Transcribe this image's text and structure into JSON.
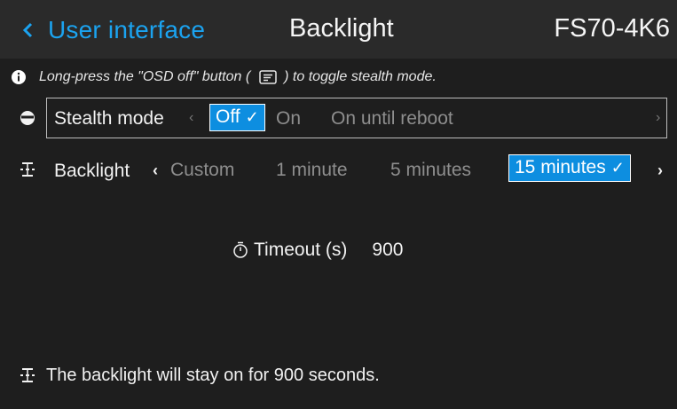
{
  "header": {
    "back_label": "User interface",
    "title": "Backlight",
    "device": "FS70-4K6"
  },
  "info": {
    "text_before": "Long-press the \"OSD off\" button (",
    "text_after": ") to toggle stealth mode."
  },
  "stealth": {
    "label": "Stealth mode",
    "options": [
      "Off",
      "On",
      "On until reboot"
    ],
    "selected": "Off",
    "check": "✓"
  },
  "backlight": {
    "label": "Backlight",
    "options": [
      "Custom",
      "1 minute",
      "5 minutes",
      "15 minutes"
    ],
    "selected": "15 minutes",
    "check": "✓"
  },
  "timeout": {
    "label": "Timeout (s)",
    "value": "900"
  },
  "status": {
    "text": "The backlight will stay on for 900 seconds."
  },
  "colors": {
    "accent": "#1ba3f0",
    "selected_bg": "#0d8ee0",
    "header_bg": "#2a2a2a",
    "content_bg": "#1e1e1e"
  },
  "icons": {
    "back": "chevron-left-icon",
    "info": "info-icon",
    "osd_key": "osd-key-icon",
    "stealth": "stealth-icon",
    "backlight": "backlight-icon",
    "timer": "timer-icon"
  }
}
